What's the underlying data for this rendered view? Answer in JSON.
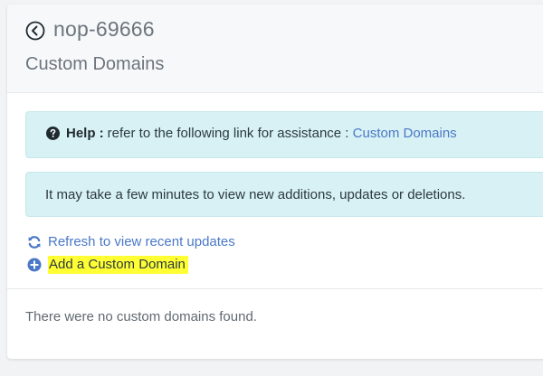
{
  "header": {
    "app_title": "nop-69666",
    "page_title": "Custom Domains"
  },
  "help_alert": {
    "label": "Help :",
    "text": "refer to the following link for assistance :",
    "link_text": "Custom Domains"
  },
  "info_alert": {
    "text": "It may take a few minutes to view new additions, updates or deletions."
  },
  "actions": {
    "refresh_label": "Refresh to view recent updates",
    "add_label": "Add a Custom Domain"
  },
  "empty_state": {
    "text": "There were no custom domains found."
  },
  "icons": {
    "back": "arrow-left-circle-icon",
    "help": "question-circle-icon",
    "refresh": "sync-icon",
    "add": "plus-circle-icon"
  },
  "colors": {
    "link": "#4a78c7",
    "alert_bg": "#d8f1f4",
    "highlight": "#ffff33",
    "muted_text": "#6c757d"
  }
}
